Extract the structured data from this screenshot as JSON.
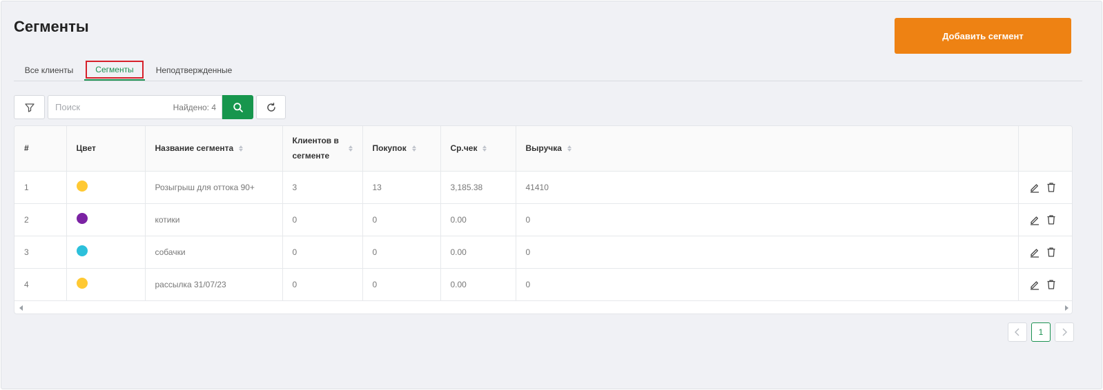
{
  "header": {
    "title": "Сегменты",
    "add_button": "Добавить сегмент"
  },
  "tabs": [
    {
      "label": "Все клиенты",
      "active": false
    },
    {
      "label": "Сегменты",
      "active": true
    },
    {
      "label": "Неподтвержденные",
      "active": false
    }
  ],
  "toolbar": {
    "search_placeholder": "Поиск",
    "found_text": "Найдено: 4"
  },
  "table": {
    "columns": [
      "#",
      "Цвет",
      "Название сегмента",
      "Клиентов в сегменте",
      "Покупок",
      "Ср.чек",
      "Выручка"
    ],
    "rows": [
      {
        "num": "1",
        "color": "#ffc933",
        "name": "Розыгрыш для оттока 90+",
        "clients": "3",
        "purchases": "13",
        "avg": "3,185.38",
        "revenue": "41410"
      },
      {
        "num": "2",
        "color": "#7b22a3",
        "name": "котики",
        "clients": "0",
        "purchases": "0",
        "avg": "0.00",
        "revenue": "0"
      },
      {
        "num": "3",
        "color": "#2cc0db",
        "name": "собачки",
        "clients": "0",
        "purchases": "0",
        "avg": "0.00",
        "revenue": "0"
      },
      {
        "num": "4",
        "color": "#ffc933",
        "name": "рассылка 31/07/23",
        "clients": "0",
        "purchases": "0",
        "avg": "0.00",
        "revenue": "0"
      }
    ]
  },
  "pagination": {
    "current_page": "1"
  },
  "icons": {
    "filter": "filter-icon",
    "search": "search-icon",
    "refresh": "refresh-icon",
    "edit": "edit-icon",
    "delete": "trash-icon"
  },
  "colors": {
    "accent_orange": "#ee8213",
    "accent_green": "#17964d",
    "tab_highlight": "#d6202a"
  }
}
